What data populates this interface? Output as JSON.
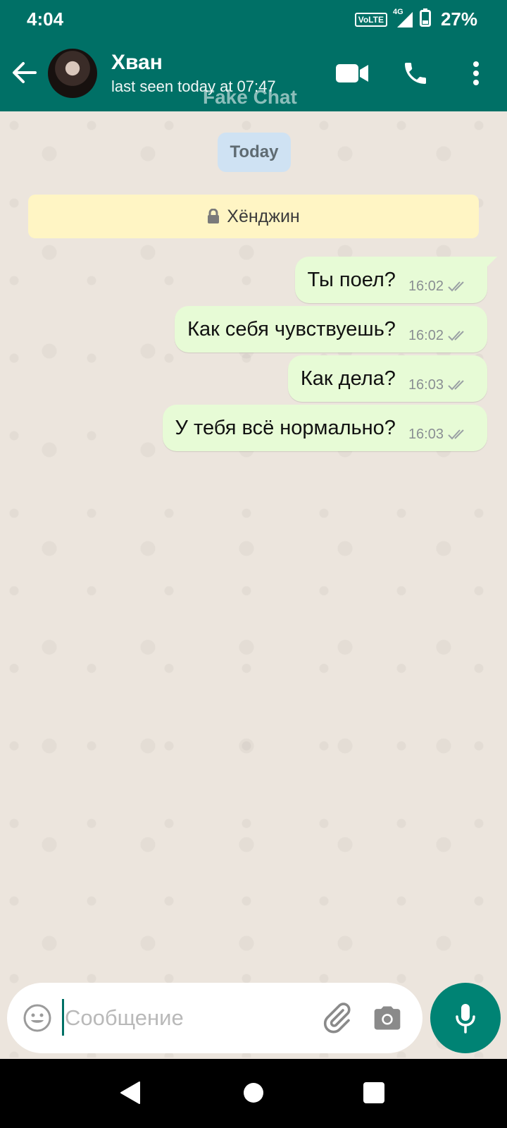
{
  "status_bar": {
    "time": "4:04",
    "network_badge": "VoLTE",
    "network_type": "4G",
    "battery_percent": "27%"
  },
  "header": {
    "contact_name": "Хван",
    "last_seen": "last seen today at 07:47",
    "watermark": "Fake Chat",
    "icons": [
      "back-arrow-icon",
      "video-call-icon",
      "voice-call-icon",
      "more-options-icon"
    ]
  },
  "chat": {
    "date_label": "Today",
    "encryption_banner": "Хёнджин",
    "messages": [
      {
        "text": "Ты поел?",
        "time": "16:02",
        "status": "read"
      },
      {
        "text": "Как себя чувствуешь?",
        "time": "16:02",
        "status": "read"
      },
      {
        "text": "Как дела?",
        "time": "16:03",
        "status": "read"
      },
      {
        "text": "У тебя всё нормально?",
        "time": "16:03",
        "status": "read"
      }
    ]
  },
  "composer": {
    "placeholder": "Сообщение",
    "value": ""
  },
  "colors": {
    "header_bg": "#007066",
    "bubble_out": "#e7fbd6",
    "date_chip": "#cfe2f3",
    "banner": "#fff5c4",
    "mic_button": "#008374"
  }
}
